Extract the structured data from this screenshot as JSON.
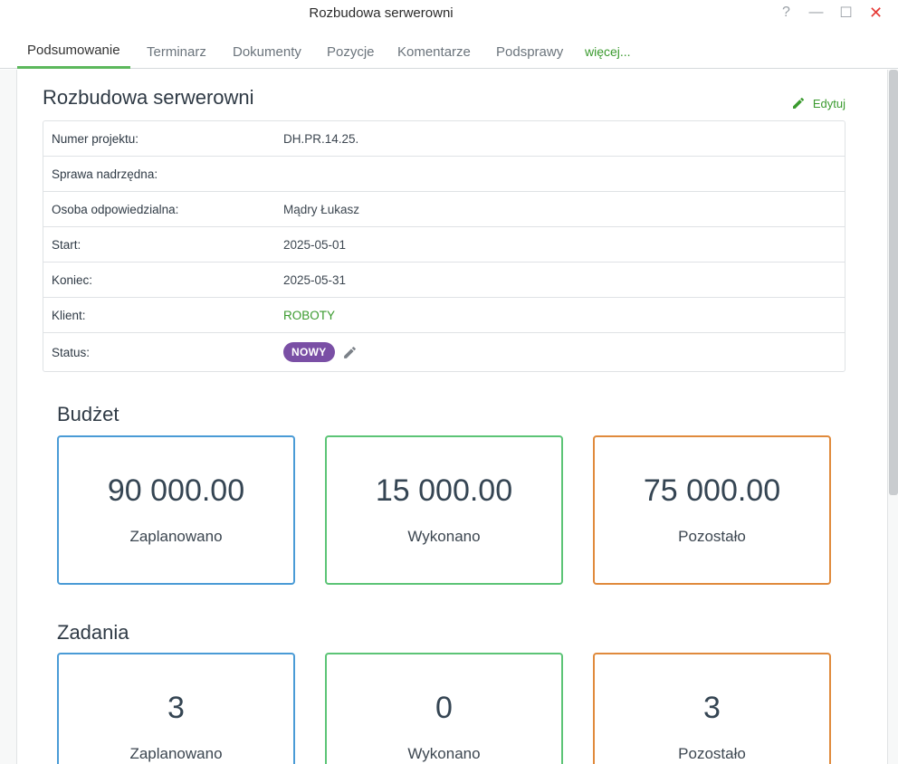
{
  "window": {
    "title": "Rozbudowa serwerowni",
    "help": "?",
    "minimize": "—",
    "maximize": "☐",
    "close": "✕"
  },
  "tabs": [
    {
      "label": "Podsumowanie",
      "active": true
    },
    {
      "label": "Terminarz"
    },
    {
      "label": "Dokumenty"
    },
    {
      "label": "Pozycje"
    },
    {
      "label": "Komentarze"
    },
    {
      "label": "Podsprawy"
    },
    {
      "label": "więcej..."
    }
  ],
  "project": {
    "title": "Rozbudowa serwerowni",
    "edit_label": "Edytuj",
    "fields": [
      {
        "label": "Numer projektu:",
        "value": "DH.PR.14.25."
      },
      {
        "label": "Sprawa nadrzędna:",
        "value": ""
      },
      {
        "label": "Osoba odpowiedzialna:",
        "value": "Mądry Łukasz"
      },
      {
        "label": "Start:",
        "value": "2025-05-01"
      },
      {
        "label": "Koniec:",
        "value": "2025-05-31"
      },
      {
        "label": "Klient:",
        "value": "ROBOTY"
      },
      {
        "label": "Status:",
        "value": "NOWY"
      }
    ]
  },
  "budget": {
    "title": "Budżet",
    "cards": [
      {
        "value": "90 000.00",
        "caption": "Zaplanowano"
      },
      {
        "value": "15 000.00",
        "caption": "Wykonano"
      },
      {
        "value": "75 000.00",
        "caption": "Pozostało"
      }
    ]
  },
  "tasks": {
    "title": "Zadania",
    "cards": [
      {
        "value": "3",
        "caption": "Zaplanowano"
      },
      {
        "value": "0",
        "caption": "Wykonano"
      },
      {
        "value": "3",
        "caption": "Pozostało"
      }
    ]
  },
  "colors": {
    "accent_green": "#3a9a2e",
    "status_badge": "#7a4fa5",
    "card_blue": "#4a9bd6",
    "card_green": "#5cc476",
    "card_orange": "#e08a3c"
  }
}
